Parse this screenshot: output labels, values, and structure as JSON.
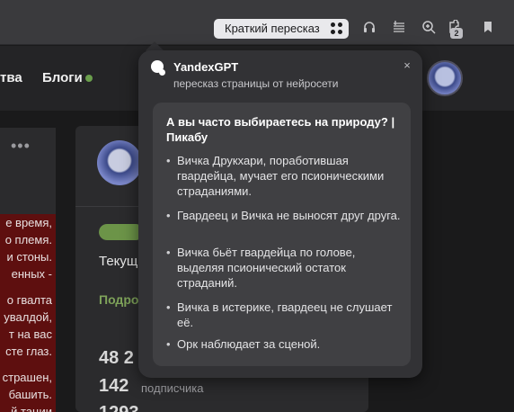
{
  "toolbar": {
    "summary_label": "Краткий пересказ",
    "icons": [
      "headphones-icon",
      "reader-icon",
      "zoom-icon",
      "extensions-icon",
      "bookmark-icon"
    ],
    "extensions_badge": "2"
  },
  "site_nav": {
    "partial_left": "тва",
    "blogs": "Блоги"
  },
  "left_post": {
    "menu": "•••",
    "lines": [
      "е время,",
      "о племя.",
      "и стоны.",
      "енных -",
      "",
      "о гвалта",
      "увалдой,",
      "т на вас",
      "сте глаз.",
      "",
      "страшен,",
      "башить.",
      "й тации"
    ]
  },
  "profile": {
    "progress": 1.0,
    "current_partial": "Текущ",
    "subscribe_partial": "Подро",
    "stat1_num": "48 2",
    "stat2_num": "142",
    "stat2_label": "подписчика",
    "stat3_num": "1293"
  },
  "popup": {
    "title": "YandexGPT",
    "subtitle": "пересказ страницы от нейросети",
    "close": "×",
    "article_title": "А вы часто выбираетесь на природу? | Пикабу",
    "bullets": [
      "Вичка Друкхари, поработившая гвардейца, мучает его псионическими страданиями.",
      "Гвардеец и Вичка не выносят друг друга.",
      "Вичка бьёт гвардейца по голове, выделяя псионический остаток страданий.",
      "Вичка в истерике, гвардеец не слушает её.",
      "Орк наблюдает за сценой."
    ]
  }
}
